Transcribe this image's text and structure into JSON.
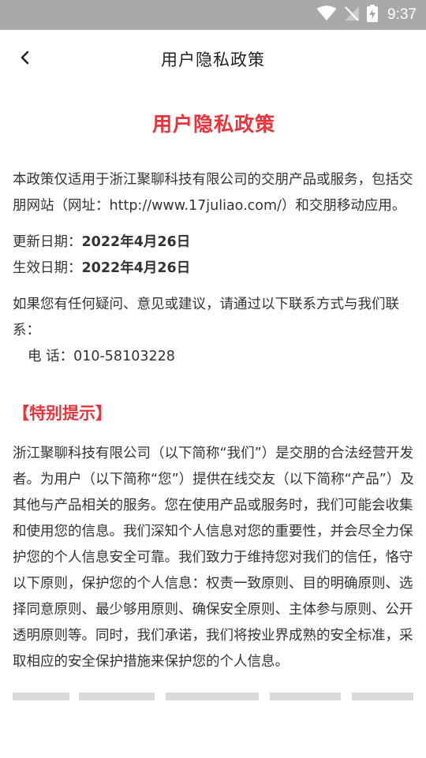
{
  "status_bar": {
    "time": "9:37",
    "icons": [
      "wifi-icon",
      "no-signal-icon",
      "battery-charging-icon"
    ]
  },
  "header": {
    "title": "用户隐私政策",
    "back_icon": "chevron-left-icon"
  },
  "document": {
    "title": "用户隐私政策",
    "intro": "本政策仅适用于浙江聚聊科技有限公司的交朋产品或服务，包括交朋网站（网址：http://www.17juliao.com/）和交朋移动应用。",
    "updated_label": "更新日期：",
    "updated_date": "2022年4月26日",
    "effective_label": "生效日期：",
    "effective_date": "2022年4月26日",
    "contact_text": "如果您有任何疑问、意见或建议，请通过以下联系方式与我们联系：",
    "phone_label": "电 话：",
    "phone_number": "010-58103228",
    "section_title": "【特别提示】",
    "section_body": "浙江聚聊科技有限公司（以下简称“我们”）是交朋的合法经营开发者。为用户（以下简称“您”）提供在线交友（以下简称“产品”）及其他与产品相关的服务。您在使用产品或服务时，我们可能会收集和使用您的信息。我们深知个人信息对您的重要性，并会尽全力保护您的个人信息安全可靠。我们致力于维持您对我们的信任，恪守以下原则，保护您的个人信息：权责一致原则、目的明确原则、选择同意原则、最少够用原则、确保安全原则、主体参与原则、公开透明原则等。同时，我们承诺，我们将按业界成熟的安全标准，采取相应的安全保护措施来保护您的个人信息。"
  },
  "colors": {
    "accent": "#e8343b",
    "status_bar": "#a9a9a9",
    "text": "#333333"
  }
}
